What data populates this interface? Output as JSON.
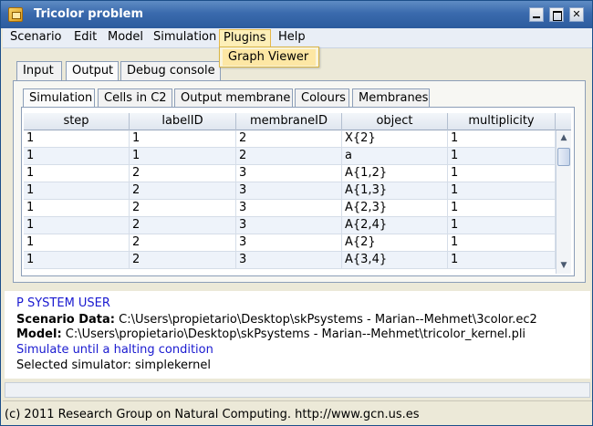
{
  "window": {
    "title": "Tricolor problem"
  },
  "menubar": [
    "Scenario",
    "Edit",
    "Model",
    "Simulation",
    "Plugins",
    "Help"
  ],
  "plugins_menu": {
    "items": [
      "Graph Viewer"
    ]
  },
  "outer_tabs": [
    "Input",
    "Output",
    "Debug console"
  ],
  "inner_tabs": [
    "Simulation",
    "Cells in C2",
    "Output membrane",
    "Colours",
    "Membranes"
  ],
  "table": {
    "columns": [
      "step",
      "labelID",
      "membraneID",
      "object",
      "multiplicity"
    ],
    "rows": [
      [
        "1",
        "1",
        "2",
        "X{2}",
        "1"
      ],
      [
        "1",
        "1",
        "2",
        "a",
        "1"
      ],
      [
        "1",
        "2",
        "3",
        "A{1,2}",
        "1"
      ],
      [
        "1",
        "2",
        "3",
        "A{1,3}",
        "1"
      ],
      [
        "1",
        "2",
        "3",
        "A{2,3}",
        "1"
      ],
      [
        "1",
        "2",
        "3",
        "A{2,4}",
        "1"
      ],
      [
        "1",
        "2",
        "3",
        "A{2}",
        "1"
      ],
      [
        "1",
        "2",
        "3",
        "A{3,4}",
        "1"
      ]
    ]
  },
  "console": {
    "user": "P SYSTEM USER",
    "scenario_label": "Scenario Data:",
    "scenario_value": "C:\\Users\\propietario\\Desktop\\skPsystems - Marian--Mehmet\\3color.ec2",
    "model_label": "Model:",
    "model_value": "C:\\Users\\propietario\\Desktop\\skPsystems - Marian--Mehmet\\tricolor_kernel.pli",
    "simulate": "Simulate until a halting condition",
    "simulator": "Selected simulator: simplekernel"
  },
  "status": "(c) 2011 Research Group on Natural Computing. http://www.gcn.us.es",
  "colors": {
    "titlebar": "#3a6aad",
    "console_blue": "#1a1ad0",
    "menu_highlight": "#fdefb8"
  }
}
